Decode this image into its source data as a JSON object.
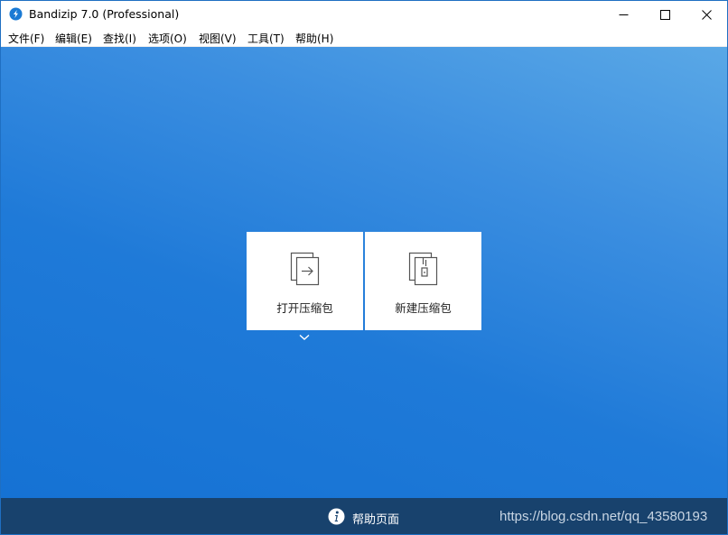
{
  "window": {
    "title": "Bandizip 7.0 (Professional)",
    "controls": [
      "minimize-icon",
      "maximize-icon",
      "close-icon"
    ]
  },
  "menu": [
    {
      "label": "文件(F)"
    },
    {
      "label": "编辑(E)"
    },
    {
      "label": "查找(I)"
    },
    {
      "label": "选项(O)"
    },
    {
      "label": "视图(V)"
    },
    {
      "label": "工具(T)"
    },
    {
      "label": "帮助(H)"
    }
  ],
  "actions": {
    "open_archive": {
      "label": "打开压缩包",
      "icon": "open-archive-icon"
    },
    "new_archive": {
      "label": "新建压缩包",
      "icon": "new-archive-icon"
    }
  },
  "footer": {
    "help_label": "帮助页面",
    "help_icon": "info-icon",
    "watermark": "https://blog.csdn.net/qq_43580193"
  },
  "colors": {
    "background_top": "#5aa8e6",
    "background_bottom": "#1572d4",
    "footer": "#18426d",
    "app_icon": "#1a7ad4"
  }
}
